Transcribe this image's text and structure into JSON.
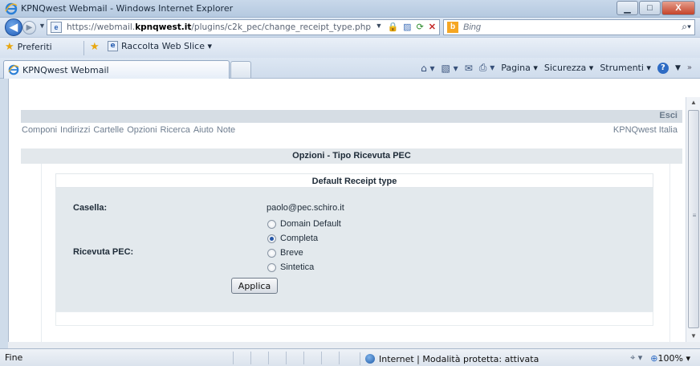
{
  "window": {
    "title": "KPNQwest Webmail - Windows Internet Explorer",
    "minimize_glyph": "▁",
    "maximize_glyph": "□",
    "close_glyph": "X"
  },
  "address": {
    "url_prefix": "https://webmail.",
    "url_domain": "kpnqwest.it",
    "url_path": "/plugins/c2k_pec/change_receipt_type.php",
    "search_placeholder": "Bing"
  },
  "favorites": {
    "favorites_label": "Preferiti",
    "web_slice_label": "Raccolta Web Slice ▾"
  },
  "tab": {
    "title": "KPNQwest Webmail"
  },
  "commandbar": {
    "page": "Pagina ▾",
    "safety": "Sicurezza ▾",
    "tools": "Strumenti ▾"
  },
  "webmail": {
    "logout": "Esci",
    "brand": "KPNQwest Italia",
    "menu": [
      "Componi",
      "Indirizzi",
      "Cartelle",
      "Opzioni",
      "Ricerca",
      "Aiuto",
      "Note"
    ],
    "page_title": "Opzioni - Tipo Ricevuta PEC",
    "section_title": "Default Receipt type",
    "mailbox_label": "Casella:",
    "mailbox_value": "paolo@pec.schiro.it",
    "receipt_label": "Ricevuta PEC:",
    "options": [
      {
        "label": "Domain Default",
        "checked": false
      },
      {
        "label": "Completa",
        "checked": true
      },
      {
        "label": "Breve",
        "checked": false
      },
      {
        "label": "Sintetica",
        "checked": false
      }
    ],
    "apply_label": "Applica"
  },
  "status": {
    "text": "Fine",
    "zone": "Internet | Modalità protetta: attivata",
    "zoom": "100%"
  },
  "colors": {
    "band": "#d6dde4",
    "form_bg": "#e3e9ed",
    "radio_selected": "#2557a8"
  }
}
